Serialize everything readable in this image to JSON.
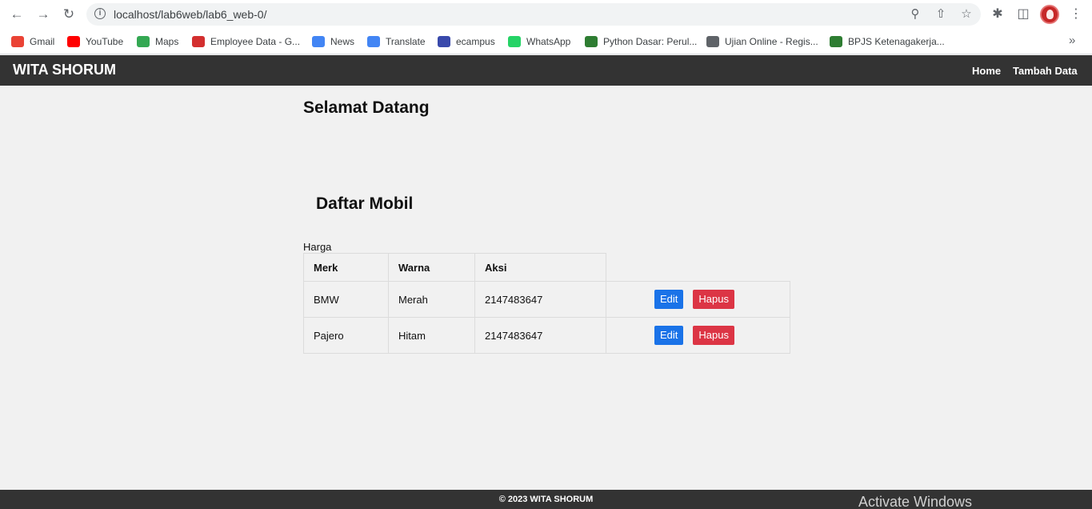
{
  "browser": {
    "url": "localhost/lab6web/lab6_web-0/",
    "bookmarks": [
      {
        "label": "Gmail",
        "icon": "gmail-icon",
        "color": "#ea4335"
      },
      {
        "label": "YouTube",
        "icon": "youtube-icon",
        "color": "#ff0000"
      },
      {
        "label": "Maps",
        "icon": "maps-icon",
        "color": "#34a853"
      },
      {
        "label": "Employee Data - G...",
        "icon": "grp-icon",
        "color": "#d32f2f"
      },
      {
        "label": "News",
        "icon": "news-icon",
        "color": "#4285f4"
      },
      {
        "label": "Translate",
        "icon": "translate-icon",
        "color": "#4285f4"
      },
      {
        "label": "ecampus",
        "icon": "ecampus-icon",
        "color": "#3949ab"
      },
      {
        "label": "WhatsApp",
        "icon": "whatsapp-icon",
        "color": "#25d366"
      },
      {
        "label": "Python Dasar: Perul...",
        "icon": "python-icon",
        "color": "#2e7d32"
      },
      {
        "label": "Ujian Online - Regis...",
        "icon": "globe-icon",
        "color": "#5f6368"
      },
      {
        "label": "BPJS Ketenagakerja...",
        "icon": "bpjs-icon",
        "color": "#2e7d32"
      }
    ]
  },
  "header": {
    "brand": "WITA SHORUM",
    "nav": [
      "Home",
      "Tambah Data"
    ]
  },
  "main": {
    "welcome": "Selamat Datang",
    "list_title": "Daftar Mobil",
    "caption": "Harga",
    "columns": [
      "Merk",
      "Warna",
      "Aksi"
    ],
    "rows": [
      {
        "merk": "BMW",
        "warna": "Merah",
        "harga": "2147483647"
      },
      {
        "merk": "Pajero",
        "warna": "Hitam",
        "harga": "2147483647"
      }
    ],
    "edit_label": "Edit",
    "delete_label": "Hapus"
  },
  "footer": {
    "text": "© 2023 WITA SHORUM",
    "watermark": "Activate Windows"
  }
}
